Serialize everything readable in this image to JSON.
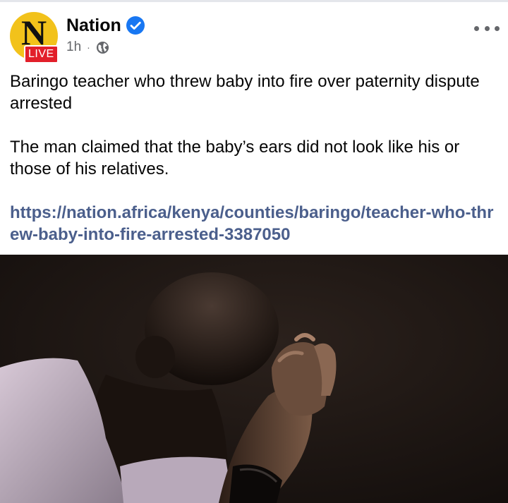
{
  "post": {
    "page_name": "Nation",
    "avatar_letter": "N",
    "live_label": "LIVE",
    "time": "1h",
    "meta_separator": "·",
    "headline": "Baringo teacher who threw baby into fire over paternity dispute arrested",
    "body": "The man claimed that the baby’s ears did not look like his or those of his relatives.",
    "link": "https://nation.africa/kenya/counties/baringo/teacher-who-threw-baby-into-fire-arrested-3387050"
  },
  "icons": {
    "verified": "verified-badge-icon",
    "audience": "globe-icon",
    "more": "more-options-icon"
  },
  "colors": {
    "avatar_bg": "#f2c21b",
    "live_badge": "#e21f2a",
    "verified_blue": "#1877f2",
    "link": "#4b5f8c",
    "meta_gray": "#65676b"
  }
}
